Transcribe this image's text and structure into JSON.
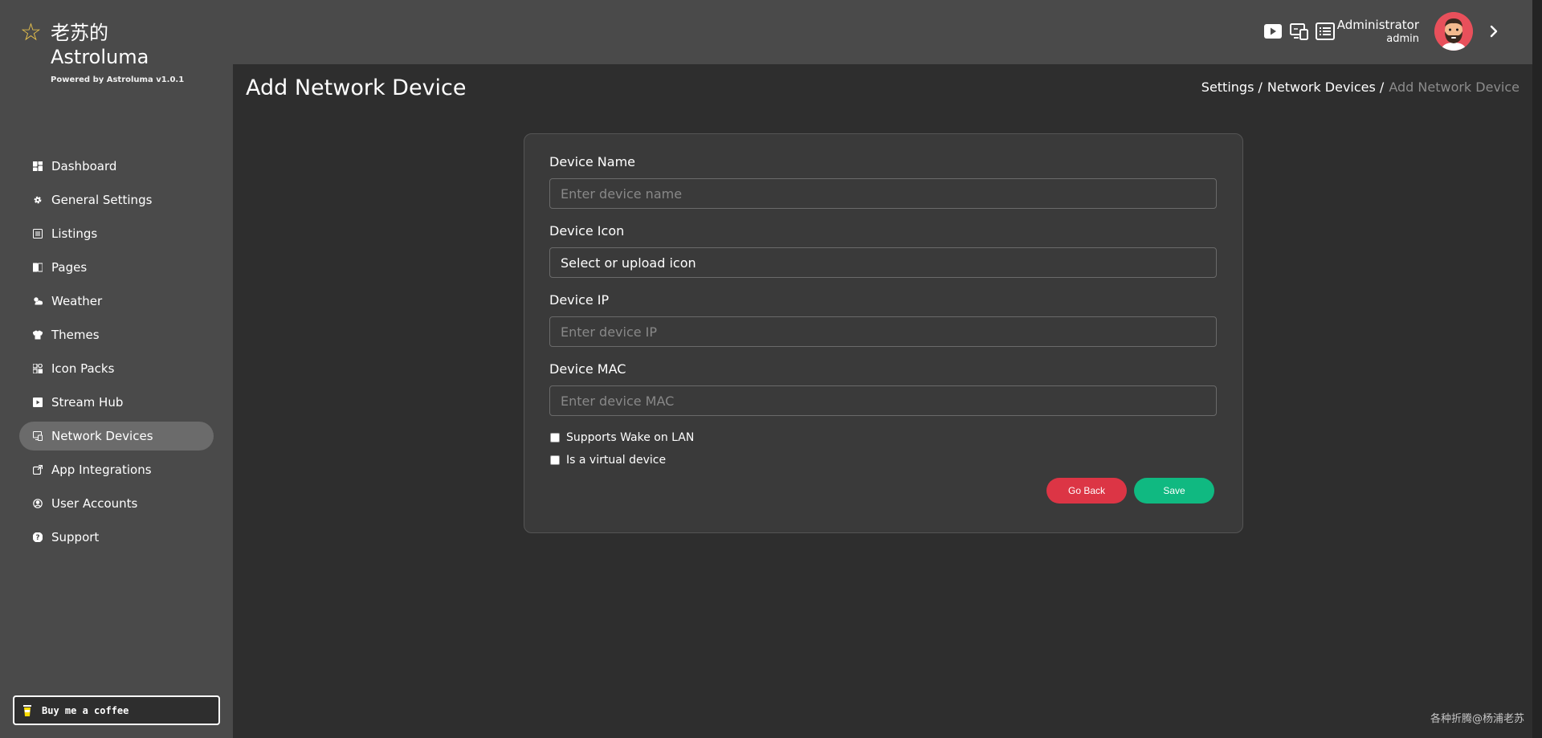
{
  "brand": {
    "title": "老苏的",
    "subtitle": "Astroluma",
    "powered": "Powered by Astroluma v1.0.1",
    "star_color": "#f2c94c"
  },
  "sidebar": {
    "items": [
      {
        "label": "Dashboard",
        "icon": "dashboard-icon"
      },
      {
        "label": "General Settings",
        "icon": "gear-icon"
      },
      {
        "label": "Listings",
        "icon": "list-icon"
      },
      {
        "label": "Pages",
        "icon": "page-icon"
      },
      {
        "label": "Weather",
        "icon": "weather-icon"
      },
      {
        "label": "Themes",
        "icon": "shirt-icon"
      },
      {
        "label": "Icon Packs",
        "icon": "icon-pack-icon"
      },
      {
        "label": "Stream Hub",
        "icon": "play-icon"
      },
      {
        "label": "Network Devices",
        "icon": "network-device-icon",
        "active": true
      },
      {
        "label": "App Integrations",
        "icon": "integration-icon"
      },
      {
        "label": "User Accounts",
        "icon": "user-icon"
      },
      {
        "label": "Support",
        "icon": "help-icon"
      }
    ],
    "coffee_label": "Buy me a coffee"
  },
  "header": {
    "user_name": "Administrator",
    "user_role": "admin"
  },
  "page": {
    "title": "Add Network Device",
    "breadcrumb": [
      "Settings",
      "Network Devices"
    ],
    "breadcrumb_current": "Add Network Device"
  },
  "form": {
    "name_label": "Device Name",
    "name_placeholder": "Enter device name",
    "icon_label": "Device Icon",
    "icon_value": "Select or upload icon",
    "ip_label": "Device IP",
    "ip_placeholder": "Enter device IP",
    "mac_label": "Device MAC",
    "mac_placeholder": "Enter device MAC",
    "wol_label": "Supports Wake on LAN",
    "virtual_label": "Is a virtual device",
    "back_label": "Go Back",
    "save_label": "Save",
    "back_color": "#dc3545",
    "save_color": "#10b981"
  },
  "footer": {
    "watermark": "各种折腾@杨浦老苏"
  }
}
